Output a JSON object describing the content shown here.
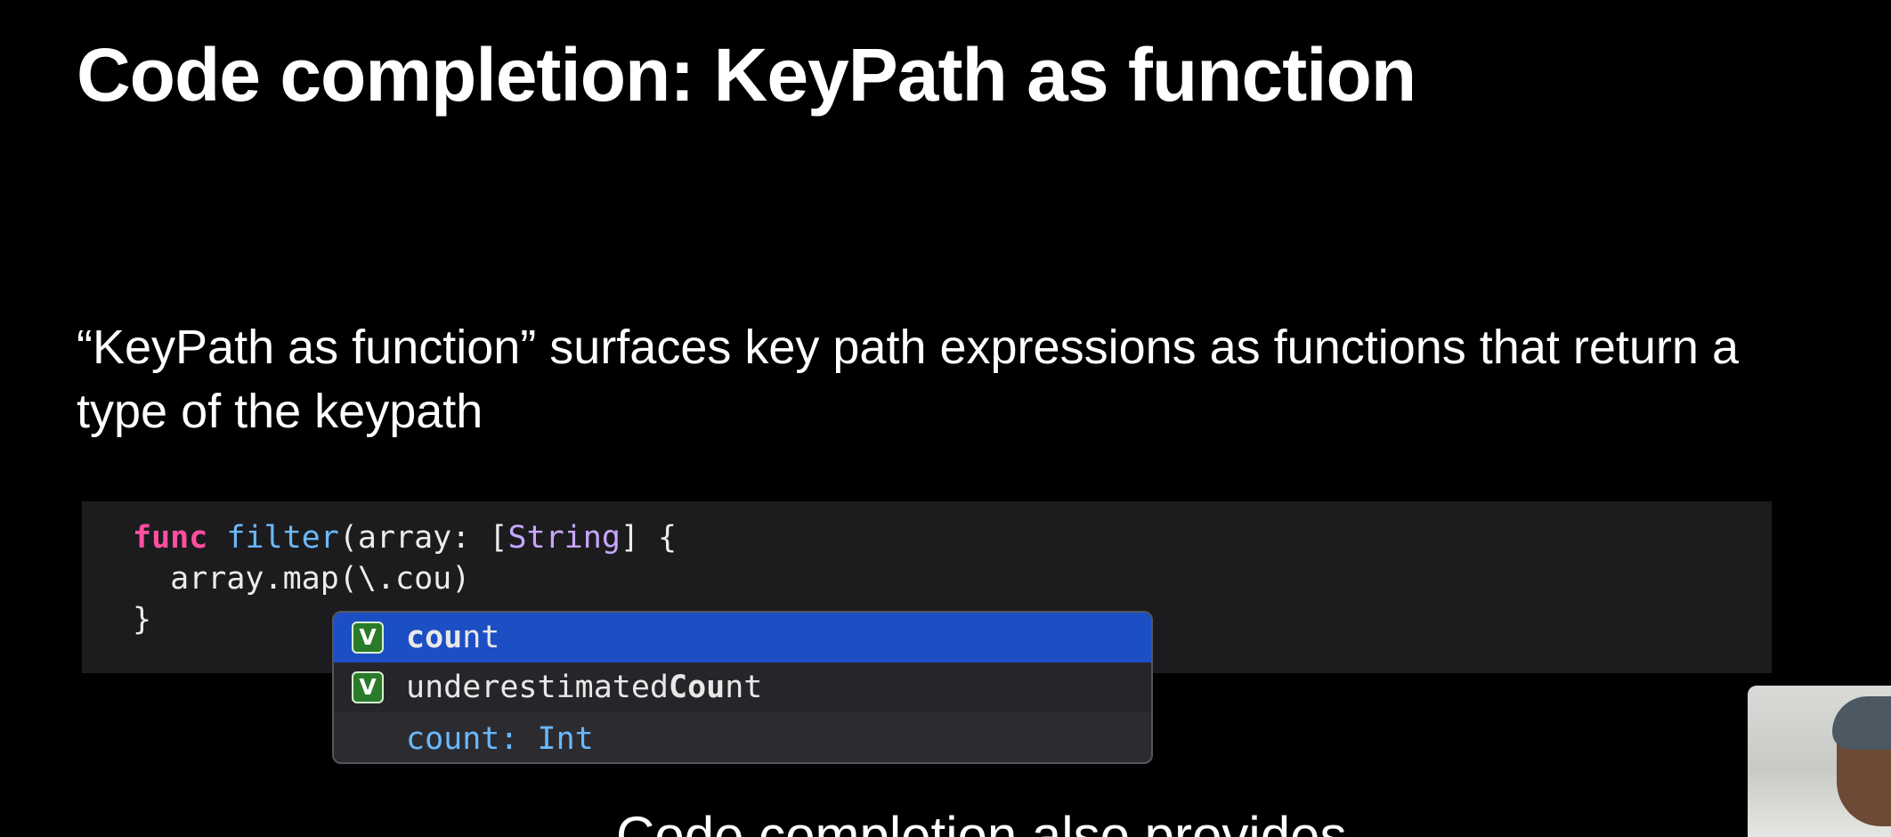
{
  "slide": {
    "title": "Code completion: KeyPath as function",
    "body_line1": "“KeyPath as function” surfaces key path expressions as functions that return a",
    "body_line2": "type of the keypath"
  },
  "code": {
    "line1": {
      "keyword": "func",
      "name": "filter",
      "open": "(array: [",
      "type": "String",
      "close": "] {"
    },
    "line2": "  array.map(\\.cou)",
    "line3": "}"
  },
  "completion": {
    "items": [
      {
        "badge": "V",
        "prefix": "cou",
        "suffix": "nt",
        "selected": true
      },
      {
        "badge": "V",
        "prefix": "underestimated",
        "match": "Cou",
        "suffix": "nt",
        "selected": false
      }
    ],
    "detail": {
      "name": "count:",
      "type": "Int"
    }
  },
  "caption": {
    "text": "Code completion also provides"
  },
  "colors": {
    "background": "#000000",
    "code_background": "#1c1c1e",
    "keyword": "#ff4fa0",
    "function_name": "#6bb8ff",
    "type_name": "#c6a6ff",
    "selection": "#1d4fc4",
    "variable_badge": "#2a7b2a"
  },
  "icons": {
    "completion_badge": "variable-badge-icon"
  }
}
